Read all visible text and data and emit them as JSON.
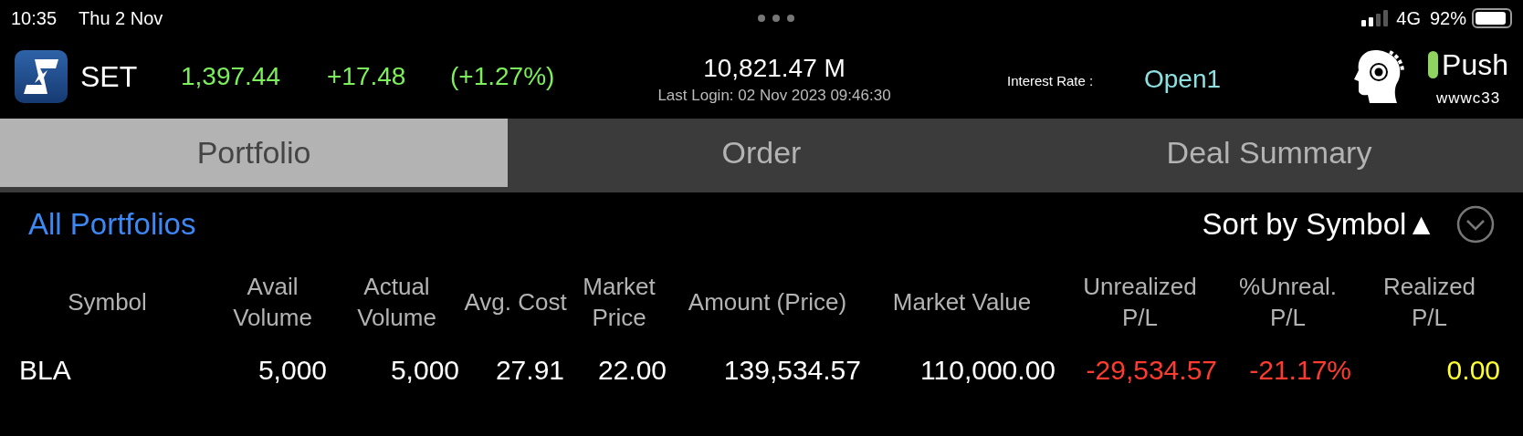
{
  "status_bar": {
    "time": "10:35",
    "date": "Thu 2 Nov",
    "network": "4G",
    "battery": "92%"
  },
  "header": {
    "index": "SET",
    "value": "1,397.44",
    "change": "+17.48",
    "change_percent": "(+1.27%)",
    "volume": "10,821.47 M",
    "last_login": "Last Login: 02 Nov 2023 09:46:30",
    "interest_label": "Interest Rate :",
    "interest_value": "Open1",
    "push": "Push",
    "user": "wwwc33"
  },
  "tabs": [
    {
      "label": "Portfolio",
      "selected": true
    },
    {
      "label": "Order",
      "selected": false
    },
    {
      "label": "Deal Summary",
      "selected": false
    }
  ],
  "portfolio_selector": "All Portfolios",
  "sort": "Sort by Symbol▲",
  "table": {
    "columns": [
      "Symbol",
      "Avail Volume",
      "Actual Volume",
      "Avg. Cost",
      "Market Price",
      "Amount (Price)",
      "Market Value",
      "Unrealized P/L",
      "%Unreal. P/L",
      "Realized P/L"
    ],
    "rows": [
      {
        "cells": [
          {
            "text": "BLA",
            "color": "#ffffff"
          },
          {
            "text": "5,000",
            "color": "#ffffff"
          },
          {
            "text": "5,000",
            "color": "#ffffff"
          },
          {
            "text": "27.91",
            "color": "#ffffff"
          },
          {
            "text": "22.00",
            "color": "#ffffff"
          },
          {
            "text": "139,534.57",
            "color": "#ffffff"
          },
          {
            "text": "110,000.00",
            "color": "#ffffff"
          },
          {
            "text": "-29,534.57",
            "color": "#ff3b30"
          },
          {
            "text": "-21.17%",
            "color": "#ff3b30"
          },
          {
            "text": "0.00",
            "color": "#ffff33"
          }
        ]
      }
    ]
  }
}
